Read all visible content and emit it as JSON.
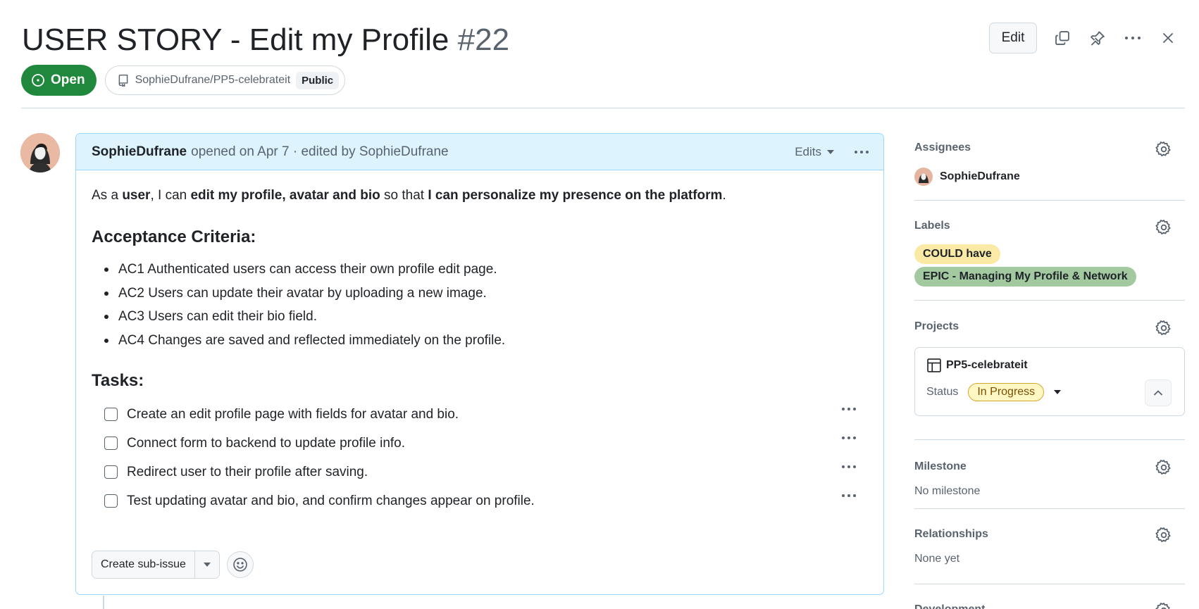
{
  "issue": {
    "title": "USER STORY - Edit my Profile",
    "number": "#22",
    "state": "Open",
    "repo": "SophieDufrane/PP5-celebrateit",
    "visibility": "Public"
  },
  "header_actions": {
    "edit_label": "Edit",
    "icons": [
      "copy-icon",
      "pin-icon",
      "more-icon",
      "close-icon"
    ]
  },
  "comment": {
    "author": "SophieDufrane",
    "meta": "opened on Apr 7 · edited by SophieDufrane",
    "edits_label": "Edits",
    "intro": {
      "p1": "As a ",
      "b1": "user",
      "p2": ", I can ",
      "b2": "edit my profile, avatar and bio",
      "p3": " so that ",
      "b3": "I can personalize my presence on the platform",
      "p4": "."
    },
    "acceptance_heading": "Acceptance Criteria:",
    "acceptance": [
      "AC1 Authenticated users can access their own profile edit page.",
      "AC2 Users can update their avatar by uploading a new image.",
      "AC3 Users can edit their bio field.",
      "AC4 Changes are saved and reflected immediately on the profile."
    ],
    "tasks_heading": "Tasks:",
    "tasks": [
      "Create an edit profile page with fields for avatar and bio.",
      "Connect form to backend to update profile info.",
      "Redirect user to their profile after saving.",
      "Test updating avatar and bio, and confirm changes appear on profile."
    ],
    "create_sub_issue_label": "Create sub-issue"
  },
  "sidebar": {
    "assignees": {
      "title": "Assignees",
      "name": "SophieDufrane"
    },
    "labels": {
      "title": "Labels",
      "items": [
        {
          "text": "COULD have",
          "bg": "#fbeaa5",
          "color": "#1f2328"
        },
        {
          "text": "EPIC - Managing My Profile & Network",
          "bg": "#a2c9a0",
          "color": "#1f2328"
        }
      ]
    },
    "projects": {
      "title": "Projects",
      "name": "PP5-celebrateit",
      "status_label": "Status",
      "status_value": "In Progress"
    },
    "milestone": {
      "title": "Milestone",
      "value": "No milestone"
    },
    "relationships": {
      "title": "Relationships",
      "value": "None yet"
    },
    "development": {
      "title": "Development"
    }
  },
  "colors": {
    "open_green": "#1f883d",
    "comment_header_bg": "#ddf4ff",
    "comment_border": "#9cd7ff"
  }
}
